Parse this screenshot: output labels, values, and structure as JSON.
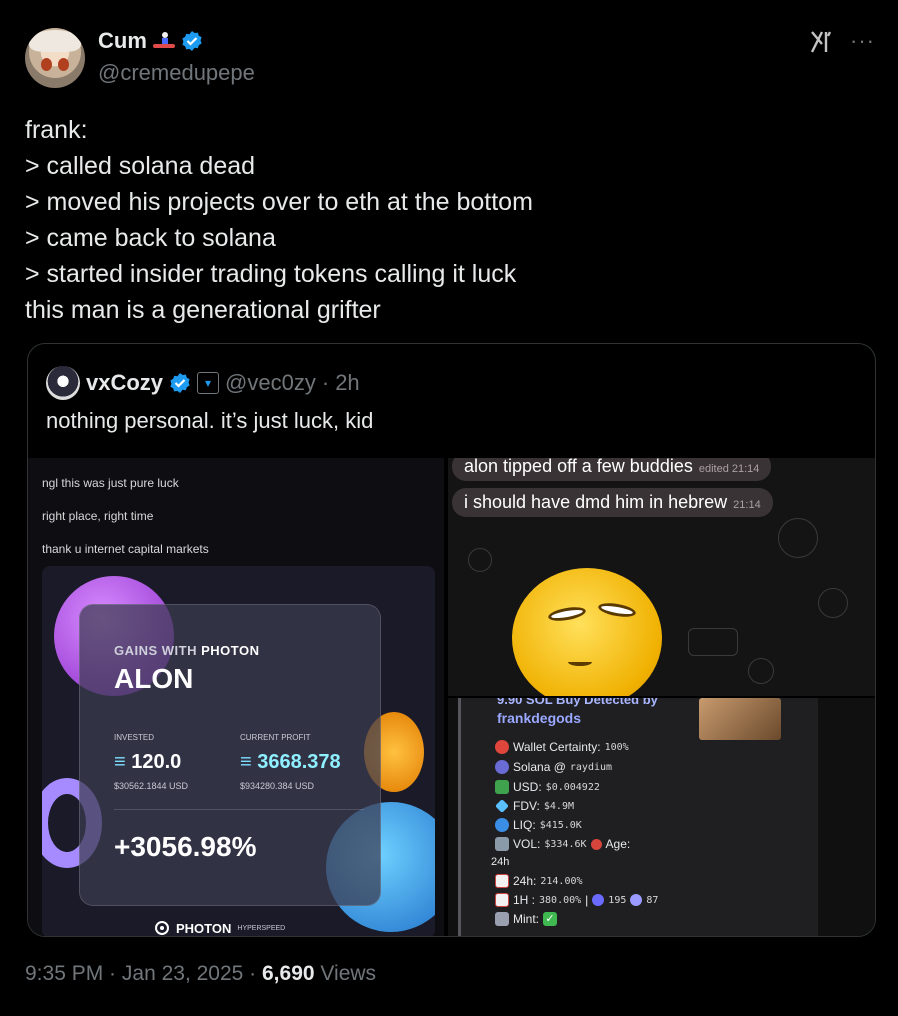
{
  "author": {
    "name": "Cum",
    "handle": "@cremedupepe"
  },
  "tweet_lines": [
    "frank:",
    "> called solana dead",
    "> moved his projects over to eth at the bottom",
    "> came back to solana",
    "> started insider trading tokens calling it luck",
    "this man is a generational grifter"
  ],
  "quote": {
    "name": "vxCozy",
    "handle": "@vec0zy",
    "time": "2h",
    "text": "nothing personal. it’s just luck, kid"
  },
  "left_image": {
    "lines": [
      "ngl this was just pure luck",
      "right place, right time",
      "thank u internet capital markets"
    ],
    "card": {
      "gains_prefix": "GAINS WITH",
      "gains_brand": "PHOTON",
      "token": "ALON",
      "invested_label": "INVESTED",
      "invested_value": "120.0",
      "invested_usd": "$30562.1844 USD",
      "profit_label": "CURRENT PROFIT",
      "profit_value": "3668.378",
      "profit_usd": "$934280.384 USD",
      "percent": "+3056.98%",
      "brand": "PHOTON",
      "brand_sub": "HYPERSPEED"
    }
  },
  "chat": {
    "bubble1": "alon tipped off a few buddies",
    "bubble1_meta": "edited 21:14",
    "bubble2": "i should have dmd him in hebrew",
    "bubble2_meta": "21:14"
  },
  "bot": {
    "header": "9.90 SOL Buy Detected by",
    "name": "frankdegods",
    "rows": [
      {
        "label": "Wallet Certainty:",
        "value": "100%"
      },
      {
        "label": "Solana @",
        "value": "raydium"
      },
      {
        "label": "USD:",
        "value": "$0.004922"
      },
      {
        "label": "FDV:",
        "value": "$4.9M"
      },
      {
        "label": "LIQ:",
        "value": "$415.0K"
      },
      {
        "label": "VOL:",
        "value": "$334.6K"
      },
      {
        "label": "24h:",
        "value": "214.00%"
      },
      {
        "label": "1H :",
        "value": "380.00%"
      },
      {
        "label": "Mint:",
        "value": ""
      }
    ],
    "age_label": "Age:",
    "age_value": "24h",
    "buys": "195",
    "sells": "87"
  },
  "footer": {
    "time": "9:35 PM",
    "date": "Jan 23, 2025",
    "views": "6,690",
    "views_label": "Views"
  },
  "colors": {
    "background": "#000000",
    "verified": "#1d9bf0",
    "muted": "#71767b",
    "text": "#e7e9ea"
  },
  "icons": [
    "verified-badge-icon",
    "grok-icon",
    "more-icon",
    "sparkle-badge-icon"
  ]
}
